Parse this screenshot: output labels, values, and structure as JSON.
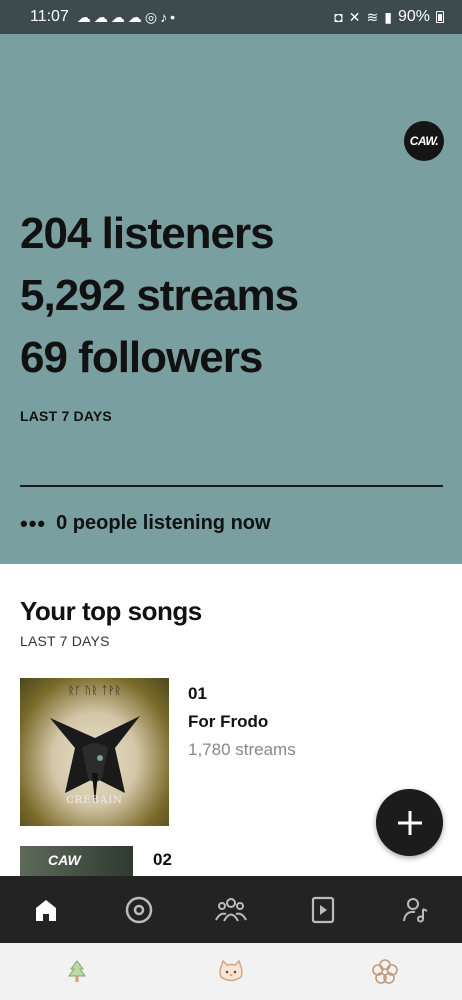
{
  "status_bar": {
    "time": "11:07",
    "battery": "90%",
    "notification_icons": [
      "app-icon",
      "app-icon",
      "app-icon",
      "app-icon",
      "instagram-icon",
      "tiktok-icon"
    ]
  },
  "hero": {
    "background_color": "#7a9fa1",
    "avatar_text": "CAW.",
    "listeners": "204 listeners",
    "streams": "5,292 streams",
    "followers": "69 followers",
    "period": "LAST 7 DAYS",
    "live_now": "0 people listening now"
  },
  "top_songs": {
    "title": "Your top songs",
    "period": "LAST 7 DAYS",
    "items": [
      {
        "rank": "01",
        "name": "For Frodo",
        "streams": "1,780 streams",
        "art_text": "ᚱᚴ ᚢᚱ ᛏᚹᚱ",
        "art_caption": "CREBAIN"
      },
      {
        "rank": "02",
        "art_text": "CAW"
      }
    ]
  },
  "bottom_nav": {
    "items": [
      "home-icon",
      "music-disc-icon",
      "audience-icon",
      "play-video-icon",
      "artist-profile-icon"
    ],
    "active": "home-icon"
  },
  "system_nav": {
    "items": [
      "tree-icon",
      "cat-face-icon",
      "flower-icon"
    ]
  }
}
